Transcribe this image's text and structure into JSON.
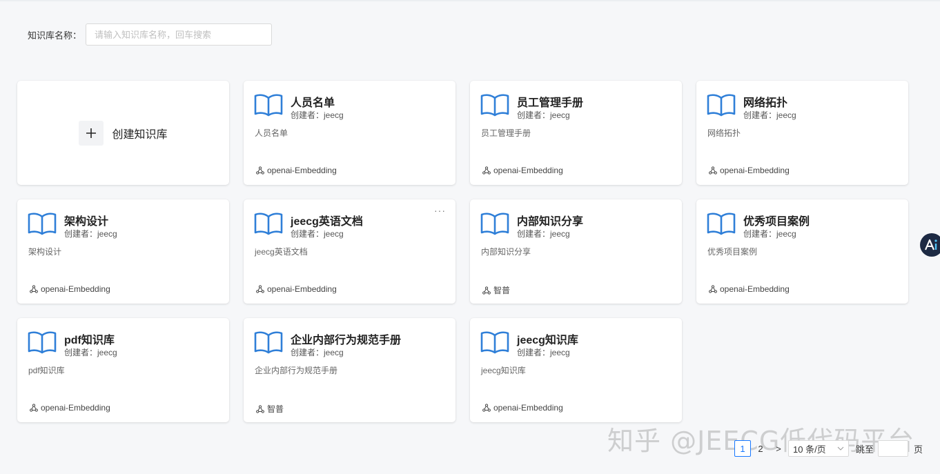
{
  "search": {
    "label": "知识库名称：",
    "placeholder": "请输入知识库名称，回车搜索",
    "value": ""
  },
  "create_card": {
    "label": "创建知识库"
  },
  "cards": [
    {
      "title": "人员名单",
      "creator": "创建者：jeecg",
      "description": "人员名单",
      "model": "openai-Embedding"
    },
    {
      "title": "员工管理手册",
      "creator": "创建者：jeecg",
      "description": "员工管理手册",
      "model": "openai-Embedding"
    },
    {
      "title": "网络拓扑",
      "creator": "创建者：jeecg",
      "description": "网络拓扑",
      "model": "openai-Embedding"
    },
    {
      "title": "架构设计",
      "creator": "创建者：jeecg",
      "description": "架构设计",
      "model": "openai-Embedding"
    },
    {
      "title": "jeecg英语文档",
      "creator": "创建者：jeecg",
      "description": "jeecg英语文档",
      "model": "openai-Embedding",
      "more": "···"
    },
    {
      "title": "内部知识分享",
      "creator": "创建者：jeecg",
      "description": "内部知识分享",
      "model": "智普"
    },
    {
      "title": "优秀项目案例",
      "creator": "创建者：jeecg",
      "description": "优秀项目案例",
      "model": "openai-Embedding"
    },
    {
      "title": "pdf知识库",
      "creator": "创建者：jeecg",
      "description": "pdf知识库",
      "model": "openai-Embedding"
    },
    {
      "title": "企业内部行为规范手册",
      "creator": "创建者：jeecg",
      "description": "企业内部行为规范手册",
      "model": "智普"
    },
    {
      "title": "jeecg知识库",
      "creator": "创建者：jeecg",
      "description": "jeecg知识库",
      "model": "openai-Embedding"
    }
  ],
  "pagination": {
    "pages": [
      "1",
      "2"
    ],
    "current": "1",
    "next": ">",
    "page_size": "10 条/页",
    "jump_label": "跳至",
    "page_suffix": "页"
  },
  "watermark": "知乎 @JEECG低代码平台",
  "colors": {
    "accent": "#1677ff",
    "book_icon": "#2f7fd8",
    "background": "#f6f7f9",
    "ai_button": "#1d2a44"
  }
}
